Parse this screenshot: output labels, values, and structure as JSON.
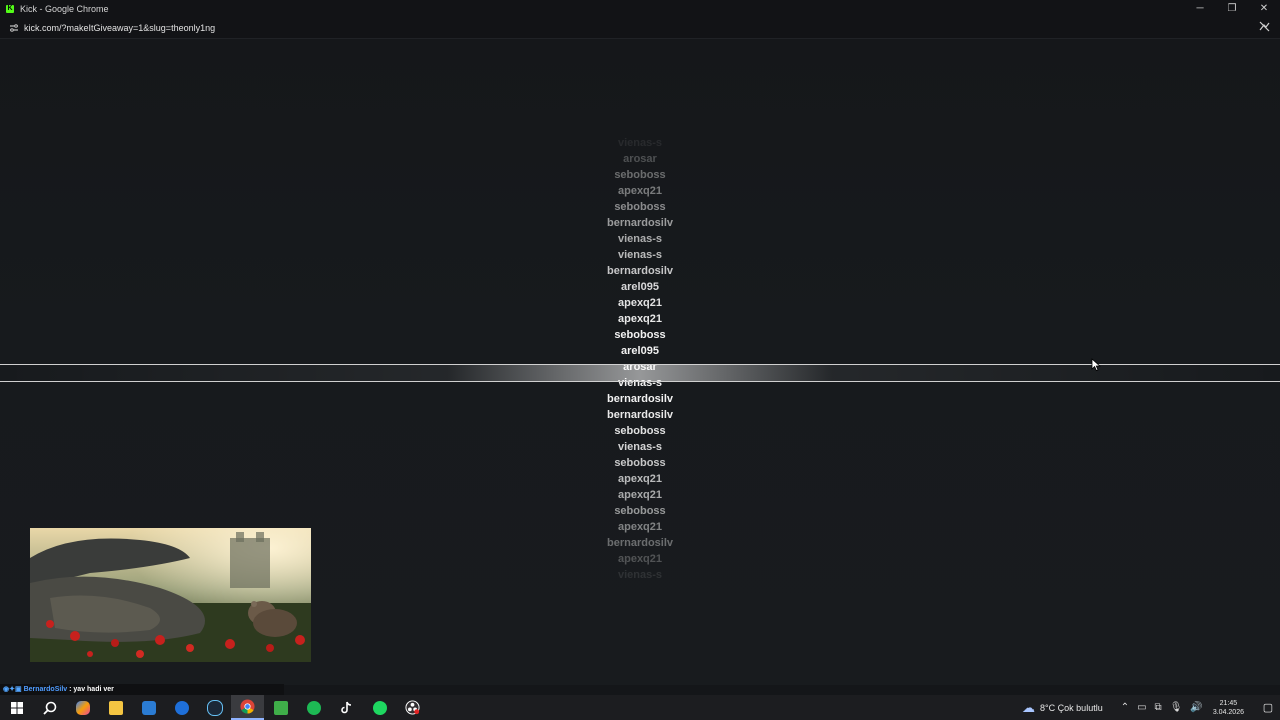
{
  "window": {
    "title": "Kick - Google Chrome",
    "app_icon": "K",
    "controls": [
      "─",
      "❐",
      "✕"
    ]
  },
  "addressbar": {
    "url": "kick.com/?makeItGiveaway=1&slug=theonly1ng"
  },
  "giveaway": {
    "selected": "arosar",
    "names_above": [
      {
        "text": "vienas-s",
        "opacity": 0.08
      },
      {
        "text": "arosar",
        "opacity": 0.25
      },
      {
        "text": "seboboss",
        "opacity": 0.38
      },
      {
        "text": "apexq21",
        "opacity": 0.45
      },
      {
        "text": "seboboss",
        "opacity": 0.52
      },
      {
        "text": "bernardosilv",
        "opacity": 0.6
      },
      {
        "text": "vienas-s",
        "opacity": 0.68
      },
      {
        "text": "vienas-s",
        "opacity": 0.74
      },
      {
        "text": "bernardosilv",
        "opacity": 0.8
      },
      {
        "text": "arel095",
        "opacity": 0.88
      },
      {
        "text": "apexq21",
        "opacity": 0.93
      },
      {
        "text": "apexq21",
        "opacity": 0.96
      },
      {
        "text": "seboboss",
        "opacity": 1
      },
      {
        "text": "arel095",
        "opacity": 1
      }
    ],
    "names_below": [
      {
        "text": "vienas-s",
        "opacity": 1
      },
      {
        "text": "bernardosilv",
        "opacity": 1
      },
      {
        "text": "bernardosilv",
        "opacity": 0.96
      },
      {
        "text": "seboboss",
        "opacity": 0.92
      },
      {
        "text": "vienas-s",
        "opacity": 0.86
      },
      {
        "text": "seboboss",
        "opacity": 0.8
      },
      {
        "text": "apexq21",
        "opacity": 0.74
      },
      {
        "text": "apexq21",
        "opacity": 0.66
      },
      {
        "text": "seboboss",
        "opacity": 0.58
      },
      {
        "text": "apexq21",
        "opacity": 0.48
      },
      {
        "text": "bernardosilv",
        "opacity": 0.38
      },
      {
        "text": "apexq21",
        "opacity": 0.26
      },
      {
        "text": "vienas-s",
        "opacity": 0.1
      }
    ]
  },
  "chat": {
    "badges": "◉✦▣",
    "user": "BernardoSilv",
    "separator": " : ",
    "message": "yav hadi ver"
  },
  "taskbar": {
    "weather_temp": "8°C",
    "weather_text": "Çok bulutlu",
    "time": "21:45",
    "date": "3.04.2026"
  },
  "colors": {
    "kick_green": "#53fc18",
    "background": "#16181b"
  }
}
